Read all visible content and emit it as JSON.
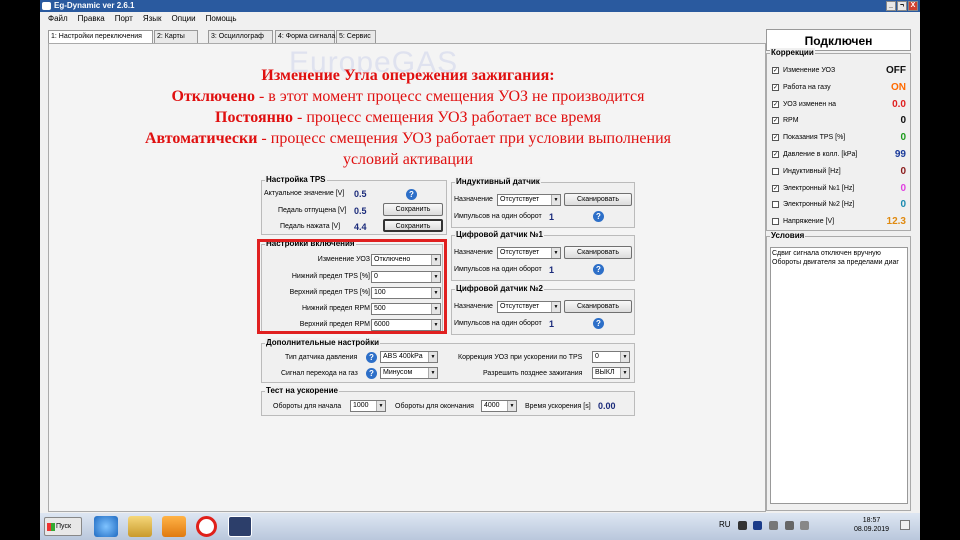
{
  "window": {
    "title": "Eg-Dynamic ver 2.6.1",
    "controls": [
      "_",
      "¬",
      "X"
    ]
  },
  "menu": [
    "Файл",
    "Правка",
    "Порт",
    "Язык",
    "Опции",
    "Помощь"
  ],
  "tabs": [
    "1: Настройки переключения",
    "2: Карты",
    "3: Осциллограф",
    "4: Форма сигнала",
    "5: Сервис"
  ],
  "watermark": "EuropeGAS",
  "heading": {
    "title": "Изменение Угла опережения зажигания:",
    "l1_key": "Отключено",
    "l1_text": " - в этот момент процесс смещения УОЗ не производится",
    "l2_key": "Постоянно",
    "l2_text": " - процесс смещения УОЗ работает все время",
    "l3_key": "Автоматически",
    "l3_text": " - процесс смещения УОЗ работает при условии выполнения",
    "l4": "условий активации"
  },
  "tps": {
    "title": "Настройка TPS",
    "actual_label": "Актуальное значение [V]",
    "actual_value": "0.5",
    "released_label": "Педаль отпущена [V]",
    "released_value": "0.5",
    "pressed_label": "Педаль нажата [V]",
    "pressed_value": "4.4",
    "save": "Сохранить"
  },
  "enable": {
    "title": "Настройки включения",
    "rows": [
      {
        "label": "Изменение УОЗ",
        "value": "Отключено"
      },
      {
        "label": "Нижний предел TPS [%]",
        "value": "0"
      },
      {
        "label": "Верхний предел TPS [%]",
        "value": "100"
      },
      {
        "label": "Нижний предел RPM",
        "value": "500"
      },
      {
        "label": "Верхний предел RPM",
        "value": "6000"
      }
    ]
  },
  "sensors": [
    {
      "title": "Индуктивный датчик",
      "assign_label": "Назначение",
      "assign_value": "Отсутствует",
      "scan": "Сканировать",
      "pulses_label": "Импульсов на один оборот",
      "pulses": "1"
    },
    {
      "title": "Цифровой датчик №1",
      "assign_label": "Назначение",
      "assign_value": "Отсутствует",
      "scan": "Сканировать",
      "pulses_label": "Импульсов на один оборот",
      "pulses": "1"
    },
    {
      "title": "Цифровой датчик №2",
      "assign_label": "Назначение",
      "assign_value": "Отсутствует",
      "scan": "Сканировать",
      "pulses_label": "Импульсов на один оборот",
      "pulses": "1"
    }
  ],
  "extra": {
    "title": "Дополнительные настройки",
    "pressure_label": "Тип датчика давления",
    "pressure_value": "ABS 400kPa",
    "signal_label": "Сигнал перехода на газ",
    "signal_value": "Минусом",
    "corr_label": "Коррекция УОЗ при ускорении по TPS",
    "corr_value": "0",
    "late_label": "Разрешить позднее зажигания",
    "late_value": "ВЫКЛ"
  },
  "accel": {
    "title": "Тест на ускорение",
    "start_label": "Обороты для начала",
    "start_value": "1000",
    "end_label": "Обороты для окончания",
    "end_value": "4000",
    "time_label": "Время ускорения [s]",
    "time_value": "0.00"
  },
  "status": "Подключен",
  "corrections": {
    "title": "Коррекции",
    "items": [
      {
        "label": "Изменение УОЗ",
        "checked": true,
        "value": "OFF",
        "color": "#111111"
      },
      {
        "label": "Работа на газу",
        "checked": true,
        "value": "ON",
        "color": "#ff6a00"
      },
      {
        "label": "УОЗ изменен на",
        "checked": true,
        "value": "0.0",
        "color": "#e02020"
      },
      {
        "label": "RPM",
        "checked": true,
        "value": "0",
        "color": "#111111"
      },
      {
        "label": "Показания TPS [%]",
        "checked": true,
        "value": "0",
        "color": "#1c9b1c"
      },
      {
        "label": "Давление в колл. [kPa]",
        "checked": true,
        "value": "99",
        "color": "#1a3a9a"
      },
      {
        "label": "Индуктивный [Hz]",
        "checked": false,
        "value": "0",
        "color": "#8a1a1a"
      },
      {
        "label": "Электронный №1 [Hz]",
        "checked": true,
        "value": "0",
        "color": "#e040e0"
      },
      {
        "label": "Электронный №2 [Hz]",
        "checked": false,
        "value": "0",
        "color": "#1a8ab0"
      },
      {
        "label": "Напряжение [V]",
        "checked": false,
        "value": "12.3",
        "color": "#e08a10"
      }
    ]
  },
  "conditions": {
    "title": "Условия",
    "lines": [
      "Сдвиг сигнала отключен вручную",
      "Обороты двигателя за пределами диаг"
    ]
  },
  "taskbar": {
    "start": "Пуск",
    "lang": "RU",
    "time": "18:57",
    "date": "08.09.2019"
  }
}
